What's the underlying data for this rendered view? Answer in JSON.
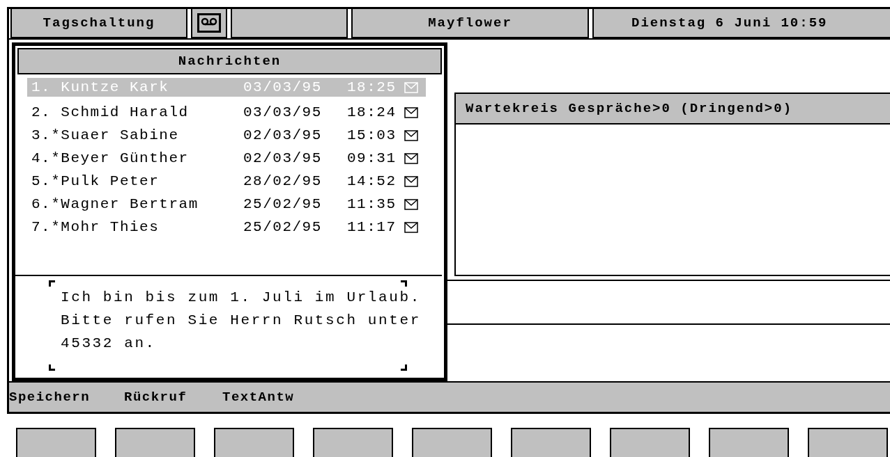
{
  "header": {
    "mode": "Tagschaltung",
    "name": "Mayflower",
    "datetime": "Dienstag 6 Juni 10:59"
  },
  "messages_panel": {
    "title": "Nachrichten",
    "messages": [
      {
        "label": "1. Kuntze Kark",
        "date": "03/03/95",
        "time": "18:25",
        "selected": true
      },
      {
        "label": "2. Schmid Harald",
        "date": "03/03/95",
        "time": "18:24",
        "selected": false
      },
      {
        "label": "3.*Suaer Sabine",
        "date": "02/03/95",
        "time": "15:03",
        "selected": false
      },
      {
        "label": "4.*Beyer Günther",
        "date": "02/03/95",
        "time": "09:31",
        "selected": false
      },
      {
        "label": "5.*Pulk Peter",
        "date": "28/02/95",
        "time": "14:52",
        "selected": false
      },
      {
        "label": "6.*Wagner Bertram",
        "date": "25/02/95",
        "time": "11:35",
        "selected": false
      },
      {
        "label": "7.*Mohr Thies",
        "date": "25/02/95",
        "time": "11:17",
        "selected": false
      }
    ],
    "text_lines": [
      "Ich bin bis zum 1. Juli im Urlaub.",
      "Bitte rufen Sie Herrn Rutsch unter",
      "45332 an."
    ]
  },
  "queue_panel": {
    "title": "Wartekreis Gespräche>0 (Dringend>0)"
  },
  "softkeys": [
    {
      "label": "Speichern"
    },
    {
      "label": "Rückruf"
    },
    {
      "label": "TextAntw"
    }
  ]
}
